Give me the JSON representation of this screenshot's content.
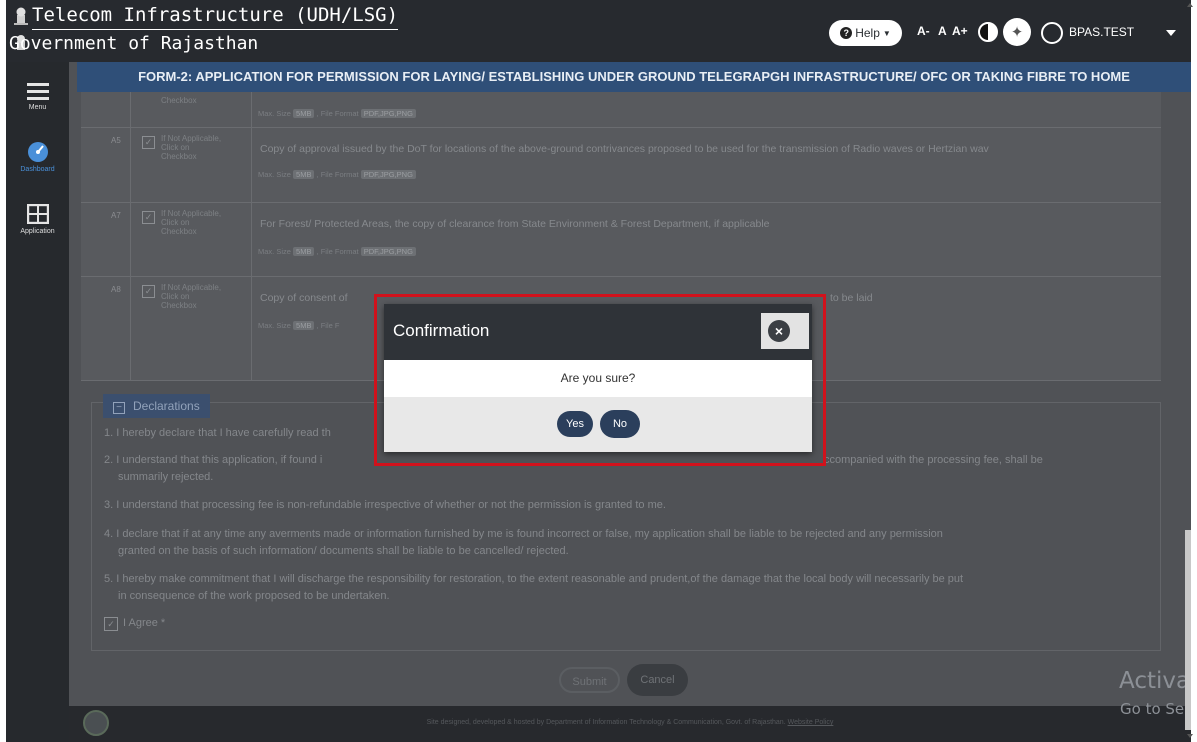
{
  "header": {
    "title_line1": "Telecom Infrastructure (UDH/LSG)",
    "title_line2": "Government of Rajasthan",
    "help_label": "Help",
    "font_small": "A-",
    "font_normal": "A",
    "font_large": "A+",
    "username": "BPAS.TEST"
  },
  "sidebar": {
    "items": [
      {
        "label": "Menu",
        "icon": "hamburger-icon"
      },
      {
        "label": "Dashboard",
        "icon": "speedometer-icon"
      },
      {
        "label": "Application",
        "icon": "grid-icon"
      }
    ]
  },
  "form": {
    "banner": "FORM-2: APPLICATION FOR PERMISSION FOR LAYING/ ESTABLISHING UNDER GROUND TELEGRAPGH INFRASTRUCTURE/ OFC OR TAKING FIBRE TO HOME",
    "top_partial": {
      "na_fragment": "Checkbox",
      "max_size": "Max. Size",
      "size": "5MB",
      "format_label": ", File Format",
      "formats": "PDF,JPG,PNG"
    },
    "documents": [
      {
        "id": "A5",
        "na_label": "If Not Applicable, Click on Checkbox",
        "description": "Copy of approval issued by the DoT for locations of the above-ground contrivances proposed to be used for the transmission of Radio waves or Hertzian wav",
        "max_size": "Max. Size",
        "size": "5MB",
        "format_label": ", File Format",
        "formats": "PDF,JPG,PNG"
      },
      {
        "id": "A7",
        "na_label": "If Not Applicable, Click on Checkbox",
        "description": "For Forest/ Protected Areas, the copy of clearance from State Environment & Forest Department, if applicable",
        "max_size": "Max. Size",
        "size": "5MB",
        "format_label": ", File Format",
        "formats": "PDF,JPG,PNG"
      },
      {
        "id": "A8",
        "na_label": "If Not Applicable, Click on Checkbox",
        "description": "Copy of consent of",
        "description_tail": "to be laid",
        "max_size": "Max. Size",
        "size": "5MB",
        "format_label": ", File F",
        "formats": ""
      }
    ],
    "declarations_title": "Declarations",
    "declarations": [
      "1. I hereby declare that I have carefully read th",
      "2. I understand that this application, if found i",
      "ccompanied with the processing fee, shall be",
      "summarily rejected.",
      "3. I understand that processing fee is non-refundable irrespective of whether or not the permission is granted to me.",
      "4. I declare that if at any time any averments made or information furnished by me is found incorrect or false, my application shall be liable to be rejected and any permission",
      "granted on the basis of such information/ documents shall be liable to be cancelled/ rejected.",
      "5. I hereby make commitment that I will discharge the responsibility for restoration, to the extent reasonable and prudent,of the damage that the local body will necessarily be put",
      "in consequence of the work proposed to be undertaken."
    ],
    "agree_label": "I Agree *",
    "submit_label": "Submit",
    "cancel_label": "Cancel"
  },
  "footer": {
    "text": "Site designed, developed & hosted by Department of Information Technology & Communication, Govt. of Rajasthan.",
    "link": "Website Policy"
  },
  "watermark": {
    "line1": "Activat",
    "line2": "Go to Se"
  },
  "modal": {
    "title": "Confirmation",
    "message": "Are you sure?",
    "yes_label": "Yes",
    "no_label": "No"
  },
  "colors": {
    "banner": "#2f4f78",
    "modal_button": "#2b3f5c",
    "highlight": "#d1121c"
  }
}
